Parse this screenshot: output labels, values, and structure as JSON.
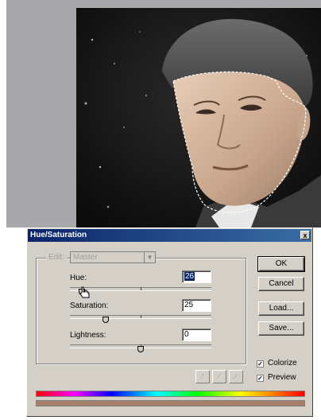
{
  "dialog": {
    "title": "Hue/Saturation",
    "close_label": "x",
    "edit_label": "Edit:",
    "edit_value": "Master",
    "hue": {
      "label": "Hue:",
      "value": "26"
    },
    "saturation": {
      "label": "Saturation:",
      "value": "25"
    },
    "lightness": {
      "label": "Lightness:",
      "value": "0"
    },
    "buttons": {
      "ok": "OK",
      "cancel": "Cancel",
      "load": "Load...",
      "save": "Save..."
    },
    "colorize": {
      "label": "Colorize",
      "checked": true
    },
    "preview": {
      "label": "Preview",
      "checked": true
    }
  },
  "icons": {
    "dropdown": "chevron-down-icon",
    "eyedroppers": [
      "eyedropper-icon",
      "eyedropper-plus-icon",
      "eyedropper-minus-icon"
    ],
    "pointer": "hand-cursor-icon"
  },
  "colors": {
    "titlebar": "#0a246a",
    "dialog_bg": "#d4d0c8",
    "tint": "#a8806a"
  }
}
